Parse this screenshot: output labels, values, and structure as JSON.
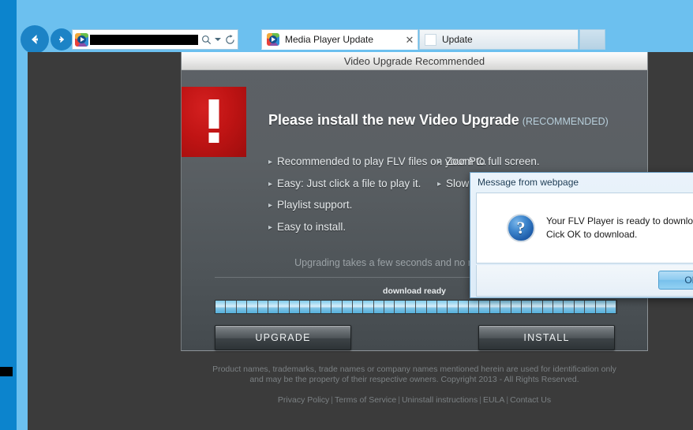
{
  "browser": {
    "back_icon": "back-arrow-icon",
    "forward_icon": "forward-arrow-icon",
    "address": {
      "url_text": "",
      "placeholder": "",
      "favicon": "media-player-favicon",
      "search_icon": "search-icon",
      "dropdown_icon": "chevron-down-icon",
      "refresh_icon": "refresh-icon",
      "redacted": true
    },
    "tabs": [
      {
        "label": "Media Player Update",
        "active": true,
        "favicon": "media-player-favicon",
        "close_label": "✕"
      },
      {
        "label": "Update",
        "active": false,
        "favicon": "blank-page-icon"
      }
    ],
    "new_tab_label": ""
  },
  "page": {
    "panel_title": "Video Upgrade Recommended",
    "alert_icon": "exclamation-mark-icon",
    "headline_main": "Please install the new Video Upgrade",
    "headline_sub": "(RECOMMENDED)",
    "features_left": [
      "Recommended to play FLV files on your PC.",
      "Easy: Just click a file to play it.",
      "Playlist support.",
      "Easy to install."
    ],
    "features_right": [
      "Zoom to full screen.",
      "Slow motion option."
    ],
    "bullet_glyph": "▸",
    "note": "Upgrading takes a few seconds and no restart needed.",
    "download_label": "download ready",
    "progress": {
      "segments": 38,
      "percent": 100,
      "fill_color": "#a9dcf2"
    },
    "buttons": {
      "upgrade_label": "UPGRADE",
      "install_label": "INSTALL"
    },
    "footer": {
      "legal_line1": "Product names, trademarks, trade names or company names mentioned herein are used for identification only",
      "legal_line2": "and may be the property of their respective owners. Copyright 2013 - All Rights Reserved.",
      "links": [
        "Privacy Policy",
        "Terms of Service",
        "Uninstall instructions",
        "EULA",
        "Contact Us"
      ],
      "link_separator": "|"
    }
  },
  "dialog": {
    "title": "Message from webpage",
    "icon": "question-mark-icon",
    "icon_glyph": "?",
    "message_line1": "Your FLV Player is ready to download!",
    "message_line2": "Cick OK to download.",
    "ok_label": "OK"
  },
  "colors": {
    "browser_chrome": "#6cc0ef",
    "desktop": "#0c84cd",
    "page_background": "#3b3b3b",
    "panel_background": "#5b6064",
    "alert_red": "#c01414",
    "progress_blue": "#a9dcf2",
    "accent_link": "#7b8083",
    "headline_sub": "#b8cfdb"
  }
}
